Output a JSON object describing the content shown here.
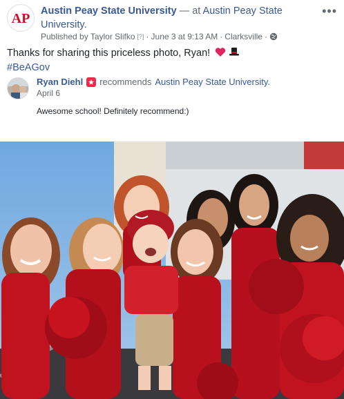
{
  "post": {
    "page_name": "Austin Peay State University",
    "at_text": " — at ",
    "location_name": "Austin Peay State University.",
    "published_by": "Published by Taylor Slifko",
    "help_marker": "[?]",
    "date": "June 3 at 9:13 AM",
    "place": "Clarksville",
    "privacy_icon": "globe-icon",
    "more_icon": "more-dots-icon",
    "more_label": "•••",
    "text": "Thanks for sharing this priceless photo, Ryan!",
    "emoji": [
      "heart",
      "top-hat"
    ],
    "hashtag": "#BeAGov",
    "logo_text": "AP",
    "brand_color": "#c8102e",
    "link_color": "#385898"
  },
  "recommendation": {
    "user_name": "Ryan Diehl",
    "action": "recommends",
    "target": "Austin Peay State University.",
    "date": "April 6",
    "text": "Awesome school! Definitely recommend:)",
    "badge_icon": "recommendation-badge-icon"
  },
  "photo": {
    "description_icon": "group-photo"
  }
}
